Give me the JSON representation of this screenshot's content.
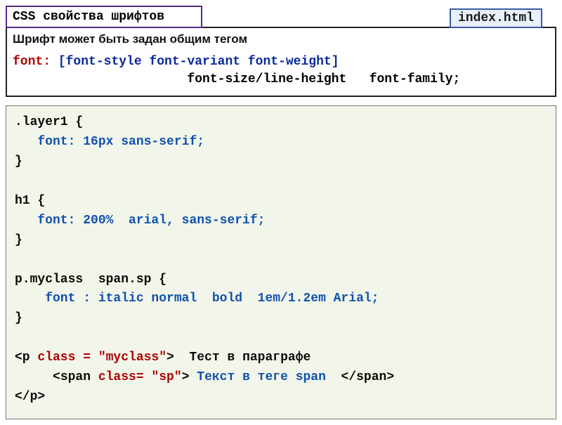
{
  "header": {
    "title": "CSS свойства шрифтов",
    "filename": "index.html"
  },
  "info": {
    "caption": "Шрифт может быть задан общим тегом",
    "kw": "font:",
    "bracket": "[font-style font-variant font-weight]",
    "line2_indent": "                       ",
    "line2": "font-size/line-height   font-family;"
  },
  "code": {
    "r1_sel": ".layer1 {",
    "r1_prop": "   font: 16px sans-serif;",
    "r1_close": "}",
    "blank": "",
    "r2_sel": "h1 {",
    "r2_prop": "   font: 200%  arial, sans-serif;",
    "r2_close": "}",
    "r3_sel": "p.myclass  span.sp {",
    "r3_prop": "    font : italic normal  bold  1em/1.2em Arial;",
    "r3_close": "}",
    "h1_open": "<p ",
    "h1_attr": "class = \"myclass\"",
    "h1_rest": ">  Тест в параграфе",
    "h2_pad": "     ",
    "h2_open": "<span ",
    "h2_attr": "class= \"sp\"",
    "h2_close": ">",
    "h2_text": " Текст в теге span  ",
    "h2_end": "</span>",
    "h3": "</p>"
  }
}
